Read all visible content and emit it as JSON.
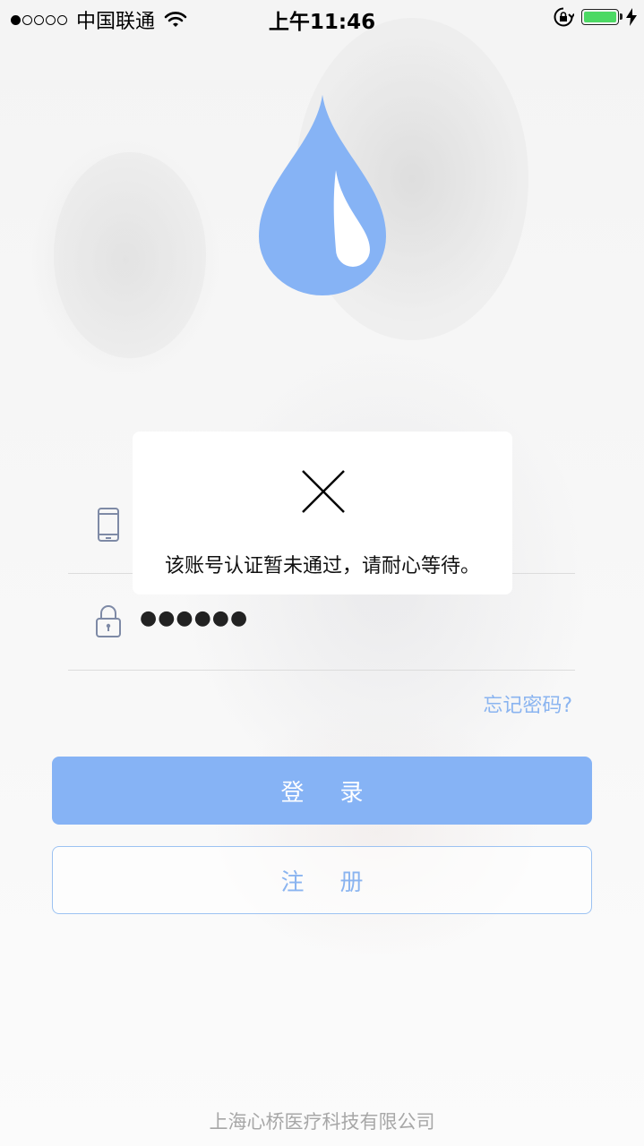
{
  "status_bar": {
    "carrier": "中国联通",
    "time": "上午11:46",
    "signal_bars_filled": 1,
    "signal_bars_total": 5,
    "battery_level": 1.0,
    "battery_color": "#4cd964"
  },
  "logo": {
    "icon": "water-drop-icon",
    "color": "#86b3f5"
  },
  "form": {
    "phone_icon": "phone-icon",
    "password_icon": "lock-icon",
    "password_value": "●●●●●●",
    "forgot_password": "忘记密码?"
  },
  "buttons": {
    "login_label": "登录",
    "register_label": "注册",
    "accent_color": "#86b3f5"
  },
  "toast": {
    "icon": "close-icon",
    "message": "该账号认证暂未通过，请耐心等待。"
  },
  "footer": {
    "company": "上海心桥医疗科技有限公司"
  }
}
